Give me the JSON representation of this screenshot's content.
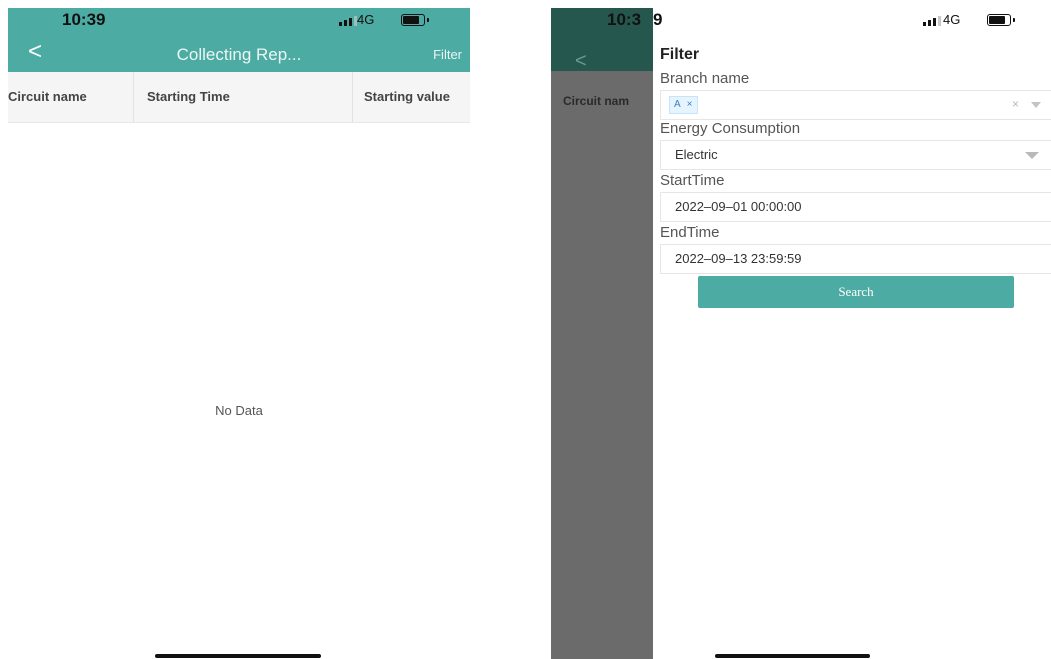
{
  "left_screen": {
    "status": {
      "time": "10:39",
      "network": "4G"
    },
    "nav": {
      "back_icon": "chevron-left-icon",
      "back_glyph": "<",
      "title": "Collecting Rep...",
      "filter_label": "Filter"
    },
    "table": {
      "headers": [
        "Circuit name",
        "Starting Time",
        "Starting value"
      ]
    },
    "empty_text": "No Data"
  },
  "right_screen": {
    "status": {
      "time_prefix": "10:3",
      "time_suffix": "9",
      "network": "4G"
    },
    "background": {
      "back_glyph": "<",
      "header_text": "Circuit nam"
    },
    "filter_panel": {
      "title": "Filter",
      "branch": {
        "label": "Branch name",
        "chip_text": "A",
        "chip_close": "×",
        "clear_glyph": "×"
      },
      "energy": {
        "label": "Energy Consumption",
        "value": "Electric"
      },
      "start": {
        "label": "StartTime",
        "value": "2022–09–01 00:00:00"
      },
      "end": {
        "label": "EndTime",
        "value": "2022–09–13 23:59:59"
      },
      "search_label": "Search"
    }
  },
  "colors": {
    "accent": "#4caba3",
    "overlay": "#6b6b6b",
    "overlay_header": "#26574f",
    "header_bg": "#f5f5f5"
  }
}
